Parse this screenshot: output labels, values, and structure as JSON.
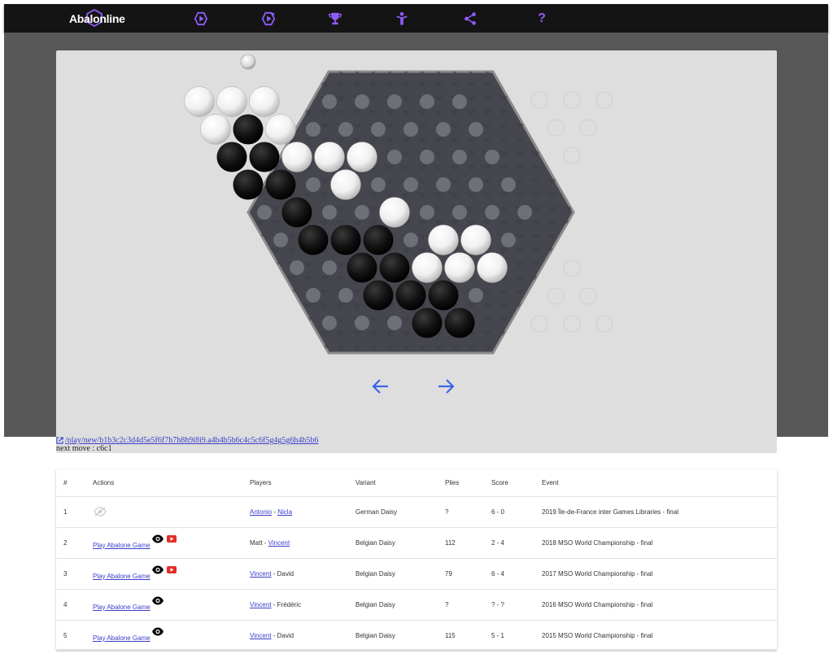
{
  "header": {
    "logo_text": "Abalonline",
    "nav_icons": [
      "play-circle-icon",
      "play-circle-icon",
      "trophy-icon",
      "person-icon",
      "share-icon",
      "help-icon"
    ],
    "help_label": "?",
    "accent": "#8e5cf7"
  },
  "board": {
    "black": [
      "a4",
      "a5",
      "b3",
      "b4",
      "b5",
      "c3",
      "c4",
      "d2",
      "d3",
      "d4",
      "e2",
      "f1",
      "f2",
      "g1",
      "g2",
      "h2"
    ],
    "white": [
      "c5",
      "c6",
      "c7",
      "d6",
      "d7",
      "e5",
      "f4",
      "g3",
      "g4",
      "g5",
      "h1",
      "h3",
      "i1",
      "i2",
      "i3"
    ],
    "captured_slots": 14
  },
  "navigation": {
    "prev": "arrow-left-icon",
    "next": "arrow-right-icon"
  },
  "permalink": "/play/new/b1b3c2c3d4d5e5f6f7h7h8h9i8i9.a4b4b5b6c4c5c6f5g4g5g6h4h5b6",
  "next_move": "next move : c6c1",
  "table": {
    "headers": [
      "#",
      "Actions",
      "Players",
      "Variant",
      "Plies",
      "Score",
      "Event"
    ],
    "rows": [
      {
        "n": "1",
        "action": "",
        "p1": "Antonio",
        "sep": " - ",
        "p2": "Nicla",
        "p1_link": true,
        "p2_link": true,
        "variant": "German Daisy",
        "plies": "?",
        "score": "6 - 0",
        "event": "2019 Île-de-France inter Games Libraries - final",
        "eye": "hidden",
        "yt": false
      },
      {
        "n": "2",
        "action": "Play Abalone Game",
        "p1": "Matt",
        "sep": " - ",
        "p2": "Vincent",
        "p1_link": false,
        "p2_link": true,
        "variant": "Belgian Daisy",
        "plies": "112",
        "score": "2 - 4",
        "event": "2018 MSO World Championship - final",
        "eye": "visible",
        "yt": true
      },
      {
        "n": "3",
        "action": "Play Abalone Game",
        "p1": "Vincent",
        "sep": " - ",
        "p2": "David",
        "p1_link": true,
        "p2_link": false,
        "variant": "Belgian Daisy",
        "plies": "79",
        "score": "6 - 4",
        "event": "2017 MSO World Championship - final",
        "eye": "visible",
        "yt": true
      },
      {
        "n": "4",
        "action": "Play Abalone Game",
        "p1": "Vincent",
        "sep": " - ",
        "p2": "Frédéric",
        "p1_link": true,
        "p2_link": false,
        "variant": "Belgian Daisy",
        "plies": "?",
        "score": "? - ?",
        "event": "2016 MSO World Championship - final",
        "eye": "visible",
        "yt": false
      },
      {
        "n": "5",
        "action": "Play Abalone Game",
        "p1": "Vincent",
        "sep": " - ",
        "p2": "David",
        "p1_link": true,
        "p2_link": false,
        "variant": "Belgian Daisy",
        "plies": "115",
        "score": "5 - 1",
        "event": "2015 MSO World Championship - final",
        "eye": "visible",
        "yt": false
      }
    ]
  }
}
